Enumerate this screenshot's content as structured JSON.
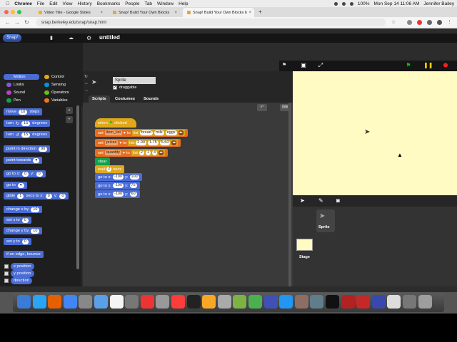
{
  "menubar": {
    "app": "Chrome",
    "items": [
      "File",
      "Edit",
      "View",
      "History",
      "Bookmarks",
      "People",
      "Tab",
      "Window",
      "Help"
    ],
    "battery": "100%",
    "datetime": "Mon Sep 14  11:06 AM",
    "user": "Jennifer Bailey"
  },
  "tabs": [
    {
      "title": "Video Title - Google Slides",
      "color": "#f4b400"
    },
    {
      "title": "Snap! Build Your Own Blocks",
      "color": "#e8a33c"
    },
    {
      "title": "Snap! Build Your Own Blocks 6",
      "color": "#e8a33c"
    }
  ],
  "url": "snap.berkeley.edu/snap/snap.html",
  "snap": {
    "logo": "Snap!",
    "project_title": "untitled",
    "categories": [
      {
        "label": "Motion",
        "color": "#4a6cd4"
      },
      {
        "label": "Control",
        "color": "#e0a81a"
      },
      {
        "label": "Looks",
        "color": "#8a55d7"
      },
      {
        "label": "Sensing",
        "color": "#0494dc"
      },
      {
        "label": "Sound",
        "color": "#bb42c3"
      },
      {
        "label": "Operators",
        "color": "#62c213"
      },
      {
        "label": "Pen",
        "color": "#0ea34a"
      },
      {
        "label": "Variables",
        "color": "#f3761d"
      }
    ],
    "palette": {
      "move": "move",
      "move_val": "10",
      "move_unit": "steps",
      "turn_cw": "turn",
      "turn_cw_val": "15",
      "turn_cw_unit": "degrees",
      "turn_ccw": "turn",
      "turn_ccw_val": "15",
      "turn_ccw_unit": "degrees",
      "point_dir": "point in direction",
      "point_dir_val": "90",
      "point_towards": "point towards",
      "goto_xy": "go to x:",
      "goto_x": "0",
      "goto_ylabel": "y:",
      "goto_y": "0",
      "goto": "go to",
      "glide": "glide",
      "glide_val": "1",
      "glide_rest": "secs to x:",
      "glide_x": "0",
      "glide_ylabel": "y:",
      "glide_y": "0",
      "change_x": "change x by",
      "change_x_val": "10",
      "set_x": "set x to",
      "set_x_val": "0",
      "change_y": "change y by",
      "change_y_val": "10",
      "set_y": "set y to",
      "set_y_val": "0",
      "bounce": "if on edge, bounce",
      "xpos": "x position",
      "ypos": "y position",
      "direction": "direction"
    },
    "sprite_name": "Sprite",
    "draggable_label": "draggable",
    "editor_tabs": [
      "Scripts",
      "Costumes",
      "Sounds"
    ],
    "script": {
      "hat_when": "when",
      "hat_clicked": "clicked",
      "set_label": "set",
      "to_label": "to",
      "list_label": "list",
      "var1": "item_list",
      "list1": [
        "bread",
        "milk",
        "eggs"
      ],
      "var2": "prices",
      "list2": [
        "2.00",
        "1.75",
        "5.50"
      ],
      "var3": "quantity",
      "list3": [
        "2",
        "1",
        "4"
      ],
      "clear": "clear",
      "wait": "wait",
      "wait_val": "2",
      "wait_unit": "secs",
      "goto": "go to x:",
      "ylabel": "y:",
      "g1x": "-100",
      "g1y": "100",
      "g2x": "-100",
      "g2y": "75",
      "g3x": "-100",
      "g3y": "60"
    },
    "corral_sprite": "Sprite",
    "corral_stage": "Stage"
  },
  "dock_colors": [
    "#3a7bd5",
    "#2aa4f4",
    "#e66000",
    "#4285f4",
    "#888",
    "#5aa0e8",
    "#f5f5f5",
    "#777",
    "#e33",
    "#999",
    "#fc3d39",
    "#222",
    "#f9a825",
    "#aaa",
    "#7cb342",
    "#4caf50",
    "#3f51b5",
    "#2196f3",
    "#8d6e63",
    "#607d8b",
    "#111",
    "#b22222",
    "#c62828",
    "#3949ab",
    "#ddd",
    "#777",
    "#9e9e9e"
  ]
}
